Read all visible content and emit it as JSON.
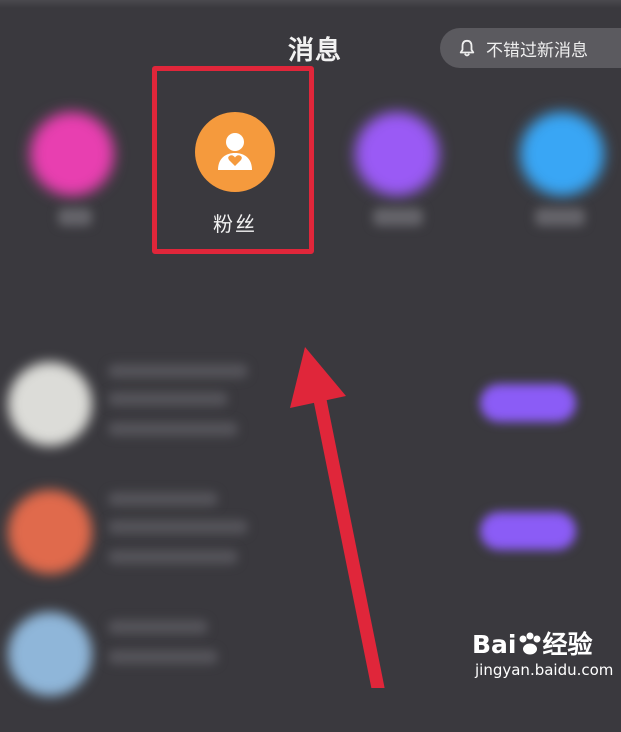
{
  "header": {
    "title": "消息",
    "notify_label": "不错过新消息"
  },
  "categories": [
    {
      "name": "likes-category",
      "color": "#e83fb0",
      "label": ""
    },
    {
      "name": "fans-category",
      "color": "#f59a3d",
      "label": "粉丝",
      "icon": "person-heart-icon",
      "highlighted": true
    },
    {
      "name": "mentions-category",
      "color": "#9a5af5",
      "label": ""
    },
    {
      "name": "comments-category",
      "color": "#39a6f5",
      "label": ""
    }
  ],
  "messages": [
    {
      "avatar_color": "#dcdcd8"
    },
    {
      "avatar_color": "#e06a4c"
    },
    {
      "avatar_color": "#8fb6d9"
    }
  ],
  "annotation": {
    "box_color": "#e0263a",
    "arrow_color": "#e0263a"
  },
  "watermark": {
    "logo_prefix": "Bai",
    "logo_suffix": "经验",
    "url": "jingyan.baidu.com"
  }
}
